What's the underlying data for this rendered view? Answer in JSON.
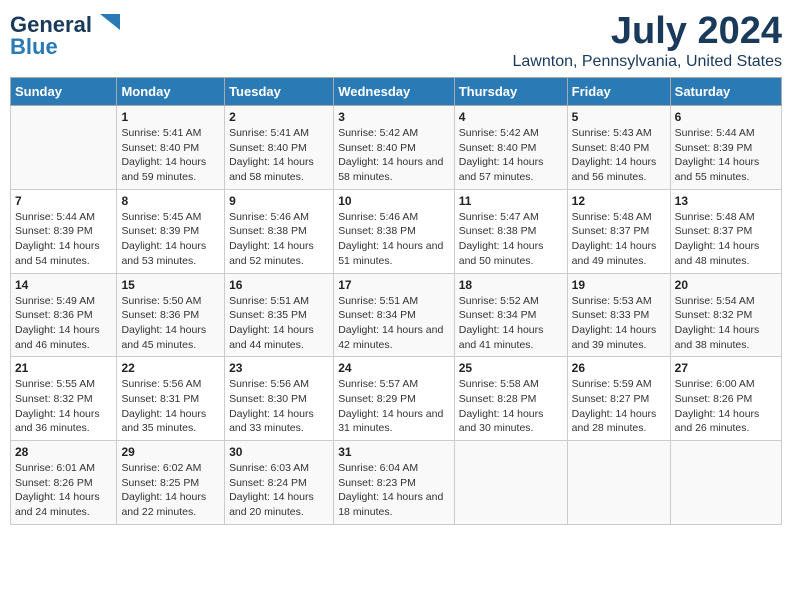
{
  "header": {
    "logo_line1": "General",
    "logo_line2": "Blue",
    "title": "July 2024",
    "subtitle": "Lawnton, Pennsylvania, United States"
  },
  "weekdays": [
    "Sunday",
    "Monday",
    "Tuesday",
    "Wednesday",
    "Thursday",
    "Friday",
    "Saturday"
  ],
  "weeks": [
    [
      {
        "day": "",
        "sunrise": "",
        "sunset": "",
        "daylight": ""
      },
      {
        "day": "1",
        "sunrise": "Sunrise: 5:41 AM",
        "sunset": "Sunset: 8:40 PM",
        "daylight": "Daylight: 14 hours and 59 minutes."
      },
      {
        "day": "2",
        "sunrise": "Sunrise: 5:41 AM",
        "sunset": "Sunset: 8:40 PM",
        "daylight": "Daylight: 14 hours and 58 minutes."
      },
      {
        "day": "3",
        "sunrise": "Sunrise: 5:42 AM",
        "sunset": "Sunset: 8:40 PM",
        "daylight": "Daylight: 14 hours and 58 minutes."
      },
      {
        "day": "4",
        "sunrise": "Sunrise: 5:42 AM",
        "sunset": "Sunset: 8:40 PM",
        "daylight": "Daylight: 14 hours and 57 minutes."
      },
      {
        "day": "5",
        "sunrise": "Sunrise: 5:43 AM",
        "sunset": "Sunset: 8:40 PM",
        "daylight": "Daylight: 14 hours and 56 minutes."
      },
      {
        "day": "6",
        "sunrise": "Sunrise: 5:44 AM",
        "sunset": "Sunset: 8:39 PM",
        "daylight": "Daylight: 14 hours and 55 minutes."
      }
    ],
    [
      {
        "day": "7",
        "sunrise": "Sunrise: 5:44 AM",
        "sunset": "Sunset: 8:39 PM",
        "daylight": "Daylight: 14 hours and 54 minutes."
      },
      {
        "day": "8",
        "sunrise": "Sunrise: 5:45 AM",
        "sunset": "Sunset: 8:39 PM",
        "daylight": "Daylight: 14 hours and 53 minutes."
      },
      {
        "day": "9",
        "sunrise": "Sunrise: 5:46 AM",
        "sunset": "Sunset: 8:38 PM",
        "daylight": "Daylight: 14 hours and 52 minutes."
      },
      {
        "day": "10",
        "sunrise": "Sunrise: 5:46 AM",
        "sunset": "Sunset: 8:38 PM",
        "daylight": "Daylight: 14 hours and 51 minutes."
      },
      {
        "day": "11",
        "sunrise": "Sunrise: 5:47 AM",
        "sunset": "Sunset: 8:38 PM",
        "daylight": "Daylight: 14 hours and 50 minutes."
      },
      {
        "day": "12",
        "sunrise": "Sunrise: 5:48 AM",
        "sunset": "Sunset: 8:37 PM",
        "daylight": "Daylight: 14 hours and 49 minutes."
      },
      {
        "day": "13",
        "sunrise": "Sunrise: 5:48 AM",
        "sunset": "Sunset: 8:37 PM",
        "daylight": "Daylight: 14 hours and 48 minutes."
      }
    ],
    [
      {
        "day": "14",
        "sunrise": "Sunrise: 5:49 AM",
        "sunset": "Sunset: 8:36 PM",
        "daylight": "Daylight: 14 hours and 46 minutes."
      },
      {
        "day": "15",
        "sunrise": "Sunrise: 5:50 AM",
        "sunset": "Sunset: 8:36 PM",
        "daylight": "Daylight: 14 hours and 45 minutes."
      },
      {
        "day": "16",
        "sunrise": "Sunrise: 5:51 AM",
        "sunset": "Sunset: 8:35 PM",
        "daylight": "Daylight: 14 hours and 44 minutes."
      },
      {
        "day": "17",
        "sunrise": "Sunrise: 5:51 AM",
        "sunset": "Sunset: 8:34 PM",
        "daylight": "Daylight: 14 hours and 42 minutes."
      },
      {
        "day": "18",
        "sunrise": "Sunrise: 5:52 AM",
        "sunset": "Sunset: 8:34 PM",
        "daylight": "Daylight: 14 hours and 41 minutes."
      },
      {
        "day": "19",
        "sunrise": "Sunrise: 5:53 AM",
        "sunset": "Sunset: 8:33 PM",
        "daylight": "Daylight: 14 hours and 39 minutes."
      },
      {
        "day": "20",
        "sunrise": "Sunrise: 5:54 AM",
        "sunset": "Sunset: 8:32 PM",
        "daylight": "Daylight: 14 hours and 38 minutes."
      }
    ],
    [
      {
        "day": "21",
        "sunrise": "Sunrise: 5:55 AM",
        "sunset": "Sunset: 8:32 PM",
        "daylight": "Daylight: 14 hours and 36 minutes."
      },
      {
        "day": "22",
        "sunrise": "Sunrise: 5:56 AM",
        "sunset": "Sunset: 8:31 PM",
        "daylight": "Daylight: 14 hours and 35 minutes."
      },
      {
        "day": "23",
        "sunrise": "Sunrise: 5:56 AM",
        "sunset": "Sunset: 8:30 PM",
        "daylight": "Daylight: 14 hours and 33 minutes."
      },
      {
        "day": "24",
        "sunrise": "Sunrise: 5:57 AM",
        "sunset": "Sunset: 8:29 PM",
        "daylight": "Daylight: 14 hours and 31 minutes."
      },
      {
        "day": "25",
        "sunrise": "Sunrise: 5:58 AM",
        "sunset": "Sunset: 8:28 PM",
        "daylight": "Daylight: 14 hours and 30 minutes."
      },
      {
        "day": "26",
        "sunrise": "Sunrise: 5:59 AM",
        "sunset": "Sunset: 8:27 PM",
        "daylight": "Daylight: 14 hours and 28 minutes."
      },
      {
        "day": "27",
        "sunrise": "Sunrise: 6:00 AM",
        "sunset": "Sunset: 8:26 PM",
        "daylight": "Daylight: 14 hours and 26 minutes."
      }
    ],
    [
      {
        "day": "28",
        "sunrise": "Sunrise: 6:01 AM",
        "sunset": "Sunset: 8:26 PM",
        "daylight": "Daylight: 14 hours and 24 minutes."
      },
      {
        "day": "29",
        "sunrise": "Sunrise: 6:02 AM",
        "sunset": "Sunset: 8:25 PM",
        "daylight": "Daylight: 14 hours and 22 minutes."
      },
      {
        "day": "30",
        "sunrise": "Sunrise: 6:03 AM",
        "sunset": "Sunset: 8:24 PM",
        "daylight": "Daylight: 14 hours and 20 minutes."
      },
      {
        "day": "31",
        "sunrise": "Sunrise: 6:04 AM",
        "sunset": "Sunset: 8:23 PM",
        "daylight": "Daylight: 14 hours and 18 minutes."
      },
      {
        "day": "",
        "sunrise": "",
        "sunset": "",
        "daylight": ""
      },
      {
        "day": "",
        "sunrise": "",
        "sunset": "",
        "daylight": ""
      },
      {
        "day": "",
        "sunrise": "",
        "sunset": "",
        "daylight": ""
      }
    ]
  ]
}
